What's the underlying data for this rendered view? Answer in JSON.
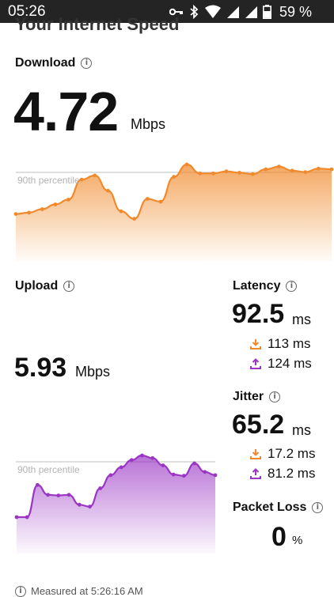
{
  "status_bar": {
    "time": "05:26",
    "battery": "59 %",
    "icons": [
      "key-icon",
      "bluetooth-icon",
      "wifi-icon",
      "signal-icon",
      "signal-icon",
      "battery-icon"
    ]
  },
  "page": {
    "title": "Your Internet Speed",
    "footer": "Measured at 5:26:16 AM"
  },
  "download": {
    "label": "Download",
    "value": "4.72",
    "unit": "Mbps",
    "percentile_label": "90th percentile",
    "color": "#f08a2c",
    "series": [
      0.28,
      0.3,
      0.35,
      0.42,
      0.49,
      0.78,
      0.84,
      0.62,
      0.32,
      0.21,
      0.5,
      0.46,
      0.82,
      1.0,
      0.87,
      0.87,
      0.9,
      0.88,
      0.86,
      0.93,
      0.97,
      0.91,
      0.89,
      0.94,
      0.93
    ]
  },
  "upload": {
    "label": "Upload",
    "value": "5.93",
    "unit": "Mbps",
    "percentile_label": "90th percentile",
    "color": "#9a35c4",
    "series": [
      0.06,
      0.06,
      0.55,
      0.4,
      0.39,
      0.4,
      0.25,
      0.22,
      0.5,
      0.7,
      0.82,
      0.93,
      1.0,
      0.96,
      0.85,
      0.71,
      0.69,
      0.88,
      0.75,
      0.7
    ]
  },
  "latency": {
    "label": "Latency",
    "value": "92.5",
    "unit": "ms",
    "download_value": "113 ms",
    "upload_value": "124 ms"
  },
  "jitter": {
    "label": "Jitter",
    "value": "65.2",
    "unit": "ms",
    "download_value": "17.2 ms",
    "upload_value": "81.2 ms"
  },
  "packet_loss": {
    "label": "Packet Loss",
    "value": "0",
    "unit": "%"
  }
}
